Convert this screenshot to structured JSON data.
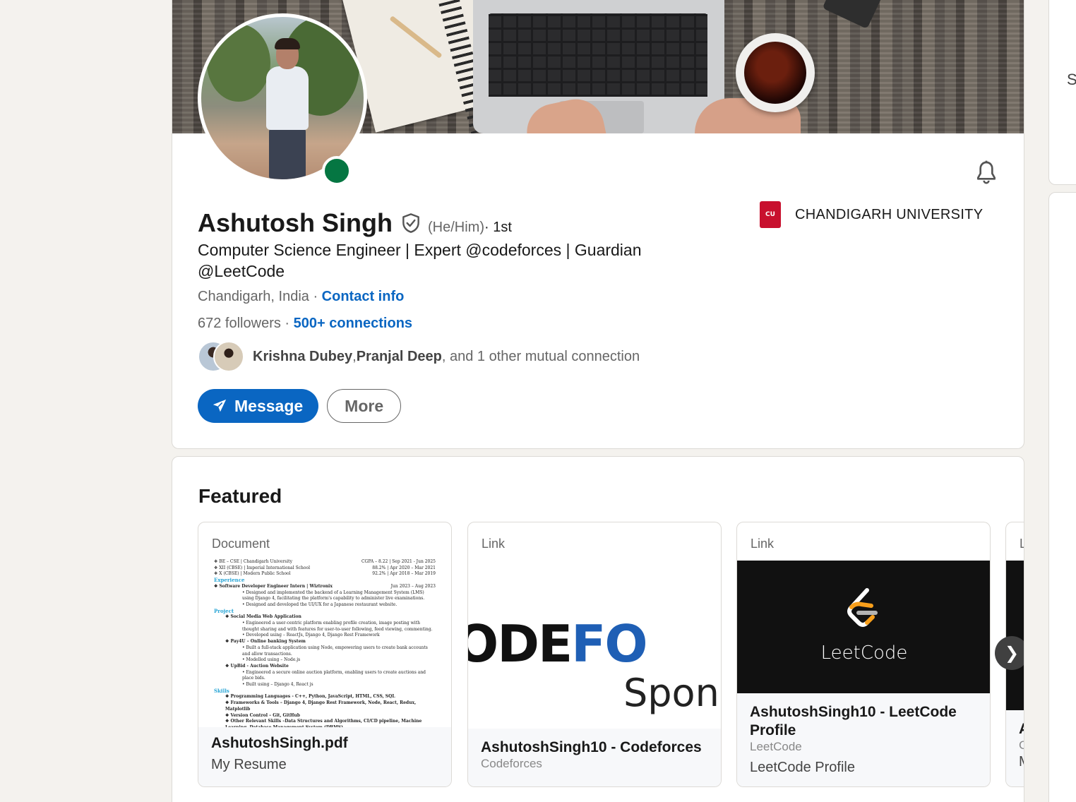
{
  "profile": {
    "name": "Ashutosh Singh",
    "pronouns": "(He/Him)",
    "degree": " · 1st",
    "headline": "Computer Science Engineer | Expert @codeforces | Guardian @LeetCode",
    "location": "Chandigarh, India",
    "location_separator": " · ",
    "contact_info": "Contact info",
    "followers_count": "672",
    "followers_label": " followers",
    "connections_separator": "  · ",
    "connections": "500+ connections",
    "mutual": {
      "name1": "Krishna Dubey",
      "sep1": ", ",
      "name2": "Pranjal Deep",
      "rest": ", and 1 other mutual connection"
    },
    "status": "online"
  },
  "education": {
    "name": "CHANDIGARH UNIVERSITY",
    "logo_text": "CU"
  },
  "actions": {
    "message": "Message",
    "more": "More"
  },
  "featured": {
    "title": "Featured",
    "items": [
      {
        "type": "Document",
        "title": "AshutoshSingh.pdf",
        "description": "My Resume"
      },
      {
        "type": "Link",
        "title": "AshutoshSingh10 - Codeforces",
        "source": "Codeforces",
        "image_text_1a": "ODE",
        "image_text_1b": "FO",
        "image_text_2": "Spons"
      },
      {
        "type": "Link",
        "title": "AshutoshSingh10 - LeetCode Profile",
        "source": "LeetCode",
        "description": "LeetCode Profile",
        "image_text": "LeetCode"
      },
      {
        "type": "L",
        "title": "A",
        "source": "C",
        "description": "M"
      }
    ],
    "next_label": "❯"
  },
  "resume": {
    "lines": [
      [
        "❖ BE – CSE | Chandigarh University",
        "CGPA – 8.22 | Sep 2021 - Jun 2025"
      ],
      [
        "❖ XII (CBSE) | Imperial International School",
        "88.2% | Apr 2020 – Mar 2021"
      ],
      [
        "❖ X (CBSE) | Modern Public School",
        "92.2% | Apr 2018 – Mar 2019"
      ]
    ],
    "sec_experience": "Experience",
    "exp_title": "❖ Software Developer Engineer Intern | Wiztronix",
    "exp_date": "Jun 2023 – Aug 2023",
    "exp_b1": "• Designed and implemented the backend of a Learning Management System (LMS) using Django 4, facilitating the platform's capability to administer live examinations.",
    "exp_b2": "• Designed and developed the UI/UX for a Japanese restaurant website.",
    "sec_project": "Project",
    "p1": "❖ Social Media Web Application",
    "p1b1": "• Engineered a user-centric platform enabling profile creation, image posting with thought sharing and with features for user-to-user following, feed viewing, commenting.",
    "p1b2": "• Developed using – ReactJs, Django 4, Django Rest Framework",
    "p2": "❖ Pay4U – Online banking System",
    "p2b1": "• Built a full-stack application using Node, empowering users to create bank accounts and allow transactions.",
    "p2b2": "• Modelled using – Node.js",
    "p3": "❖ UpBid - Auction Website",
    "p3b1": "• Engineered a secure online auction platform, enabling users to create auctions and place bids.",
    "p3b2": "• Built using – Django 4, React js",
    "sec_skills": "Skills",
    "s1": "❖ Programming Languages - C++, Python, JavaScript, HTML, CSS, SQL",
    "s2": "❖ Frameworks & Tools – Django 4, Django Rest Framework, Node, React, Redux, Matplotlib",
    "s3": "❖ Version Control – Git, GitHub",
    "s4": "❖ Other Relevant Skills –Data Structures and Algorithms, CI/CD pipeline, Machine Learning, Database Management System (DBMS)"
  },
  "sidebar": {
    "partial_letter": "S"
  },
  "colors": {
    "accent": "#0a66c2",
    "online": "#057642",
    "background": "#f4f2ee"
  }
}
